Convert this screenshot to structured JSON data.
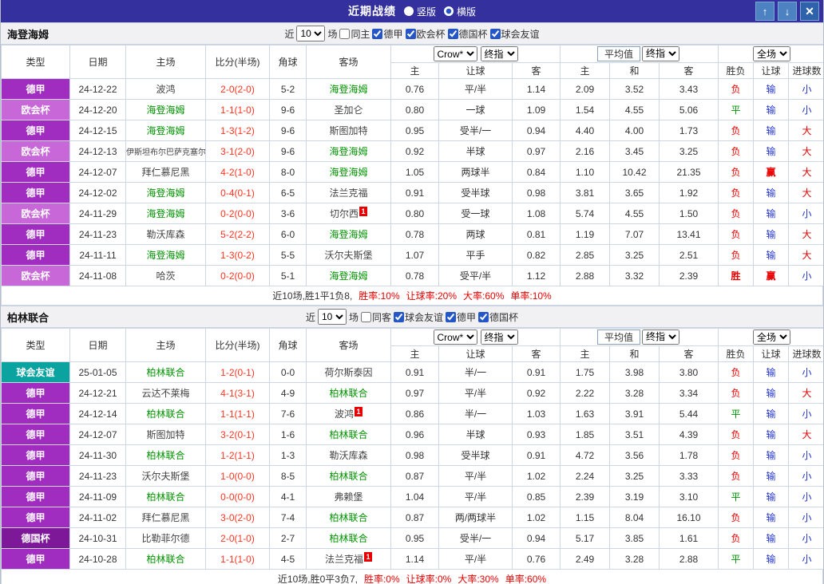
{
  "titlebar": {
    "title": "近期战绩",
    "vertical_label": "竖版",
    "horizontal_label": "横版",
    "selected_layout": "横版",
    "icons": {
      "up": "↑",
      "down": "↓",
      "close": "✕"
    }
  },
  "table_headers": {
    "left_cols": [
      "类型",
      "日期",
      "主场",
      "比分(半场)",
      "角球",
      "客场"
    ],
    "odds_cols": [
      "主",
      "让球",
      "客"
    ],
    "avg_cols": [
      "主",
      "和",
      "客"
    ],
    "result_cols": [
      "胜负",
      "让球",
      "进球数"
    ],
    "company_select": "Crow*",
    "final_select": "终指",
    "avg_label": "平均值",
    "avg_final_select": "终指",
    "scope_select": "全场"
  },
  "sections": [
    {
      "team": "海登海姆",
      "filters": {
        "near": "近",
        "count": "10",
        "games": "场",
        "same": {
          "label": "同主",
          "checked": false
        },
        "leagues": [
          {
            "label": "德甲",
            "checked": true
          },
          {
            "label": "欧会杯",
            "checked": true
          },
          {
            "label": "德国杯",
            "checked": true
          },
          {
            "label": "球会友谊",
            "checked": true
          }
        ]
      },
      "rows": [
        {
          "league": "德甲",
          "date": "24-12-22",
          "home": {
            "name": "波鸿"
          },
          "score": "2-0(2-0)",
          "corner": "5-2",
          "away": {
            "name": "海登海姆",
            "focal": true
          },
          "odds": [
            "0.76",
            "平/半",
            "1.14"
          ],
          "avg": [
            "2.09",
            "3.52",
            "3.43"
          ],
          "results": [
            {
              "t": "负",
              "c": "r"
            },
            {
              "t": "输",
              "c": "b"
            },
            {
              "t": "小",
              "c": "b"
            }
          ]
        },
        {
          "league": "欧会杯",
          "date": "24-12-20",
          "home": {
            "name": "海登海姆",
            "focal": true
          },
          "score": "1-1(1-0)",
          "corner": "9-6",
          "away": {
            "name": "圣加仑"
          },
          "odds": [
            "0.80",
            "一球",
            "1.09"
          ],
          "avg": [
            "1.54",
            "4.55",
            "5.06"
          ],
          "results": [
            {
              "t": "平",
              "c": "g"
            },
            {
              "t": "输",
              "c": "b"
            },
            {
              "t": "小",
              "c": "b"
            }
          ]
        },
        {
          "league": "德甲",
          "date": "24-12-15",
          "home": {
            "name": "海登海姆",
            "focal": true
          },
          "score": "1-3(1-2)",
          "corner": "9-6",
          "away": {
            "name": "斯图加特"
          },
          "odds": [
            "0.95",
            "受半/一",
            "0.94"
          ],
          "avg": [
            "4.40",
            "4.00",
            "1.73"
          ],
          "results": [
            {
              "t": "负",
              "c": "r"
            },
            {
              "t": "输",
              "c": "b"
            },
            {
              "t": "大",
              "c": "r"
            }
          ]
        },
        {
          "league": "欧会杯",
          "date": "24-12-13",
          "home": {
            "name": "伊斯坦布尔巴萨克塞尔"
          },
          "score": "3-1(2-0)",
          "corner": "9-6",
          "away": {
            "name": "海登海姆",
            "focal": true
          },
          "odds": [
            "0.92",
            "半球",
            "0.97"
          ],
          "avg": [
            "2.16",
            "3.45",
            "3.25"
          ],
          "results": [
            {
              "t": "负",
              "c": "r"
            },
            {
              "t": "输",
              "c": "b"
            },
            {
              "t": "大",
              "c": "r"
            }
          ]
        },
        {
          "league": "德甲",
          "date": "24-12-07",
          "home": {
            "name": "拜仁慕尼黑"
          },
          "score": "4-2(1-0)",
          "corner": "8-0",
          "away": {
            "name": "海登海姆",
            "focal": true
          },
          "odds": [
            "1.05",
            "两球半",
            "0.84"
          ],
          "avg": [
            "1.10",
            "10.42",
            "21.35"
          ],
          "results": [
            {
              "t": "负",
              "c": "r"
            },
            {
              "t": "赢",
              "c": "r",
              "bold": true
            },
            {
              "t": "大",
              "c": "r"
            }
          ]
        },
        {
          "league": "德甲",
          "date": "24-12-02",
          "home": {
            "name": "海登海姆",
            "focal": true
          },
          "score": "0-4(0-1)",
          "corner": "6-5",
          "away": {
            "name": "法兰克福"
          },
          "odds": [
            "0.91",
            "受半球",
            "0.98"
          ],
          "avg": [
            "3.81",
            "3.65",
            "1.92"
          ],
          "results": [
            {
              "t": "负",
              "c": "r"
            },
            {
              "t": "输",
              "c": "b"
            },
            {
              "t": "大",
              "c": "r"
            }
          ]
        },
        {
          "league": "欧会杯",
          "date": "24-11-29",
          "home": {
            "name": "海登海姆",
            "focal": true
          },
          "score": "0-2(0-0)",
          "corner": "3-6",
          "away": {
            "name": "切尔西",
            "red_card": "1"
          },
          "odds": [
            "0.80",
            "受一球",
            "1.08"
          ],
          "avg": [
            "5.74",
            "4.55",
            "1.50"
          ],
          "results": [
            {
              "t": "负",
              "c": "r"
            },
            {
              "t": "输",
              "c": "b"
            },
            {
              "t": "小",
              "c": "b"
            }
          ]
        },
        {
          "league": "德甲",
          "date": "24-11-23",
          "home": {
            "name": "勒沃库森"
          },
          "score": "5-2(2-2)",
          "corner": "6-0",
          "away": {
            "name": "海登海姆",
            "focal": true
          },
          "odds": [
            "0.78",
            "两球",
            "0.81"
          ],
          "avg": [
            "1.19",
            "7.07",
            "13.41"
          ],
          "results": [
            {
              "t": "负",
              "c": "r"
            },
            {
              "t": "输",
              "c": "b"
            },
            {
              "t": "大",
              "c": "r"
            }
          ]
        },
        {
          "league": "德甲",
          "date": "24-11-11",
          "home": {
            "name": "海登海姆",
            "focal": true
          },
          "score": "1-3(0-2)",
          "corner": "5-5",
          "away": {
            "name": "沃尔夫斯堡"
          },
          "odds": [
            "1.07",
            "平手",
            "0.82"
          ],
          "avg": [
            "2.85",
            "3.25",
            "2.51"
          ],
          "results": [
            {
              "t": "负",
              "c": "r"
            },
            {
              "t": "输",
              "c": "b"
            },
            {
              "t": "大",
              "c": "r"
            }
          ]
        },
        {
          "league": "欧会杯",
          "date": "24-11-08",
          "home": {
            "name": "哈茨"
          },
          "score": "0-2(0-0)",
          "corner": "5-1",
          "away": {
            "name": "海登海姆",
            "focal": true
          },
          "odds": [
            "0.78",
            "受平/半",
            "1.12"
          ],
          "avg": [
            "2.88",
            "3.32",
            "2.39"
          ],
          "results": [
            {
              "t": "胜",
              "c": "r",
              "bold": true
            },
            {
              "t": "赢",
              "c": "r",
              "bold": true
            },
            {
              "t": "小",
              "c": "b"
            }
          ]
        }
      ],
      "summary": {
        "lead": "近10场,胜1平1负8,",
        "stats": [
          "胜率:10%",
          "让球率:20%",
          "大率:60%",
          "单率:10%"
        ]
      }
    },
    {
      "team": "柏林联合",
      "filters": {
        "near": "近",
        "count": "10",
        "games": "场",
        "same": {
          "label": "同客",
          "checked": false
        },
        "leagues": [
          {
            "label": "球会友谊",
            "checked": true
          },
          {
            "label": "德甲",
            "checked": true
          },
          {
            "label": "德国杯",
            "checked": true
          }
        ]
      },
      "rows": [
        {
          "league": "球会友谊",
          "date": "25-01-05",
          "home": {
            "name": "柏林联合",
            "focal": true
          },
          "score": "1-2(0-1)",
          "corner": "0-0",
          "away": {
            "name": "荷尔斯泰因"
          },
          "odds": [
            "0.91",
            "半/一",
            "0.91"
          ],
          "avg": [
            "1.75",
            "3.98",
            "3.80"
          ],
          "results": [
            {
              "t": "负",
              "c": "r"
            },
            {
              "t": "输",
              "c": "b"
            },
            {
              "t": "小",
              "c": "b"
            }
          ]
        },
        {
          "league": "德甲",
          "date": "24-12-21",
          "home": {
            "name": "云达不莱梅"
          },
          "score": "4-1(3-1)",
          "corner": "4-9",
          "away": {
            "name": "柏林联合",
            "focal": true
          },
          "odds": [
            "0.97",
            "平/半",
            "0.92"
          ],
          "avg": [
            "2.22",
            "3.28",
            "3.34"
          ],
          "results": [
            {
              "t": "负",
              "c": "r"
            },
            {
              "t": "输",
              "c": "b"
            },
            {
              "t": "大",
              "c": "r"
            }
          ]
        },
        {
          "league": "德甲",
          "date": "24-12-14",
          "home": {
            "name": "柏林联合",
            "focal": true
          },
          "score": "1-1(1-1)",
          "corner": "7-6",
          "away": {
            "name": "波鸿",
            "red_card": "1"
          },
          "odds": [
            "0.86",
            "半/一",
            "1.03"
          ],
          "avg": [
            "1.63",
            "3.91",
            "5.44"
          ],
          "results": [
            {
              "t": "平",
              "c": "g"
            },
            {
              "t": "输",
              "c": "b"
            },
            {
              "t": "小",
              "c": "b"
            }
          ]
        },
        {
          "league": "德甲",
          "date": "24-12-07",
          "home": {
            "name": "斯图加特"
          },
          "score": "3-2(0-1)",
          "corner": "1-6",
          "away": {
            "name": "柏林联合",
            "focal": true
          },
          "odds": [
            "0.96",
            "半球",
            "0.93"
          ],
          "avg": [
            "1.85",
            "3.51",
            "4.39"
          ],
          "results": [
            {
              "t": "负",
              "c": "r"
            },
            {
              "t": "输",
              "c": "b"
            },
            {
              "t": "大",
              "c": "r"
            }
          ]
        },
        {
          "league": "德甲",
          "date": "24-11-30",
          "home": {
            "name": "柏林联合",
            "focal": true
          },
          "score": "1-2(1-1)",
          "corner": "1-3",
          "away": {
            "name": "勒沃库森"
          },
          "odds": [
            "0.98",
            "受半球",
            "0.91"
          ],
          "avg": [
            "4.72",
            "3.56",
            "1.78"
          ],
          "results": [
            {
              "t": "负",
              "c": "r"
            },
            {
              "t": "输",
              "c": "b"
            },
            {
              "t": "小",
              "c": "b"
            }
          ]
        },
        {
          "league": "德甲",
          "date": "24-11-23",
          "home": {
            "name": "沃尔夫斯堡"
          },
          "score": "1-0(0-0)",
          "corner": "8-5",
          "away": {
            "name": "柏林联合",
            "focal": true
          },
          "odds": [
            "0.87",
            "平/半",
            "1.02"
          ],
          "avg": [
            "2.24",
            "3.25",
            "3.33"
          ],
          "results": [
            {
              "t": "负",
              "c": "r"
            },
            {
              "t": "输",
              "c": "b"
            },
            {
              "t": "小",
              "c": "b"
            }
          ]
        },
        {
          "league": "德甲",
          "date": "24-11-09",
          "home": {
            "name": "柏林联合",
            "focal": true
          },
          "score": "0-0(0-0)",
          "corner": "4-1",
          "away": {
            "name": "弗赖堡"
          },
          "odds": [
            "1.04",
            "平/半",
            "0.85"
          ],
          "avg": [
            "2.39",
            "3.19",
            "3.10"
          ],
          "results": [
            {
              "t": "平",
              "c": "g"
            },
            {
              "t": "输",
              "c": "b"
            },
            {
              "t": "小",
              "c": "b"
            }
          ]
        },
        {
          "league": "德甲",
          "date": "24-11-02",
          "home": {
            "name": "拜仁慕尼黑"
          },
          "score": "3-0(2-0)",
          "corner": "7-4",
          "away": {
            "name": "柏林联合",
            "focal": true
          },
          "odds": [
            "0.87",
            "两/两球半",
            "1.02"
          ],
          "avg": [
            "1.15",
            "8.04",
            "16.10"
          ],
          "results": [
            {
              "t": "负",
              "c": "r"
            },
            {
              "t": "输",
              "c": "b"
            },
            {
              "t": "小",
              "c": "b"
            }
          ]
        },
        {
          "league": "德国杯",
          "date": "24-10-31",
          "home": {
            "name": "比勒菲尔德"
          },
          "score": "2-0(1-0)",
          "corner": "2-7",
          "away": {
            "name": "柏林联合",
            "focal": true
          },
          "odds": [
            "0.95",
            "受半/一",
            "0.94"
          ],
          "avg": [
            "5.17",
            "3.85",
            "1.61"
          ],
          "results": [
            {
              "t": "负",
              "c": "r"
            },
            {
              "t": "输",
              "c": "b"
            },
            {
              "t": "小",
              "c": "b"
            }
          ]
        },
        {
          "league": "德甲",
          "date": "24-10-28",
          "home": {
            "name": "柏林联合",
            "focal": true
          },
          "score": "1-1(1-0)",
          "corner": "4-5",
          "away": {
            "name": "法兰克福",
            "red_card": "1"
          },
          "odds": [
            "1.14",
            "平/半",
            "0.76"
          ],
          "avg": [
            "2.49",
            "3.28",
            "2.88"
          ],
          "results": [
            {
              "t": "平",
              "c": "g"
            },
            {
              "t": "输",
              "c": "b"
            },
            {
              "t": "小",
              "c": "b"
            }
          ]
        }
      ],
      "summary": {
        "lead": "近10场,胜0平3负7,",
        "stats": [
          "胜率:0%",
          "让球率:0%",
          "大率:30%",
          "单率:60%"
        ]
      }
    }
  ]
}
